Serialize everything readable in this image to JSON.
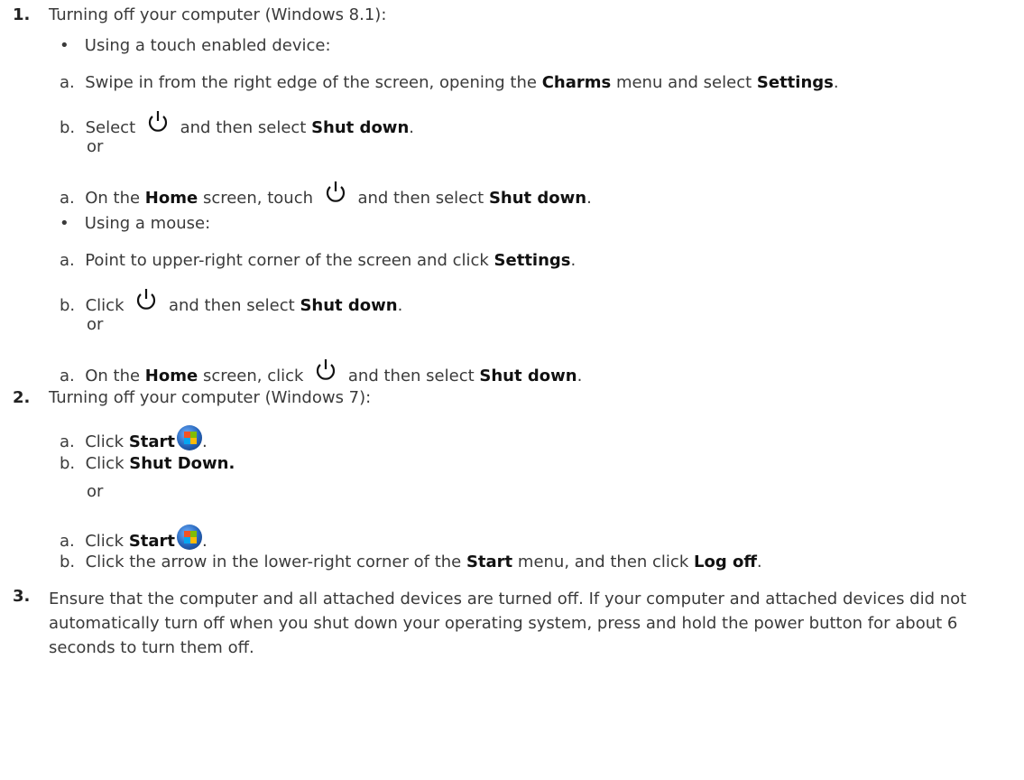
{
  "items": [
    {
      "num": "1.",
      "text": "Turning off your computer (Windows 8.1):"
    },
    {
      "num": "2.",
      "text": "Turning off your computer (Windows 7):"
    },
    {
      "num": "3.",
      "text": "Ensure that the computer and all attached devices are turned off. If your computer and attached devices did not automatically turn off when you shut down your operating system, press and hold the power button for about 6 seconds to turn them off."
    }
  ],
  "bullets": {
    "touch": "Using a touch enabled device:",
    "mouse": "Using a mouse:"
  },
  "steps": {
    "a_letter": "a.",
    "b_letter": "b.",
    "or": "or",
    "touch_a1_pre": "Swipe in from the right edge of the screen, opening the ",
    "charms": "Charms",
    "touch_a1_mid": " menu and select ",
    "settings": "Settings",
    "period": ".",
    "select": "Select",
    "and_then_select": "and then select",
    "shut_down": "Shut down",
    "on_the": "On the",
    "home": "Home",
    "screen_touch": "screen, touch",
    "point_upper": "Point to upper-right corner of the screen and click",
    "click": "Click",
    "screen_click": "screen, click",
    "start": "Start",
    "shut_down_caps": "Shut Down.",
    "arrow_text_pre": "Click the arrow in the lower-right corner of the",
    "arrow_text_mid": "menu, and then click",
    "log_off": "Log off"
  }
}
